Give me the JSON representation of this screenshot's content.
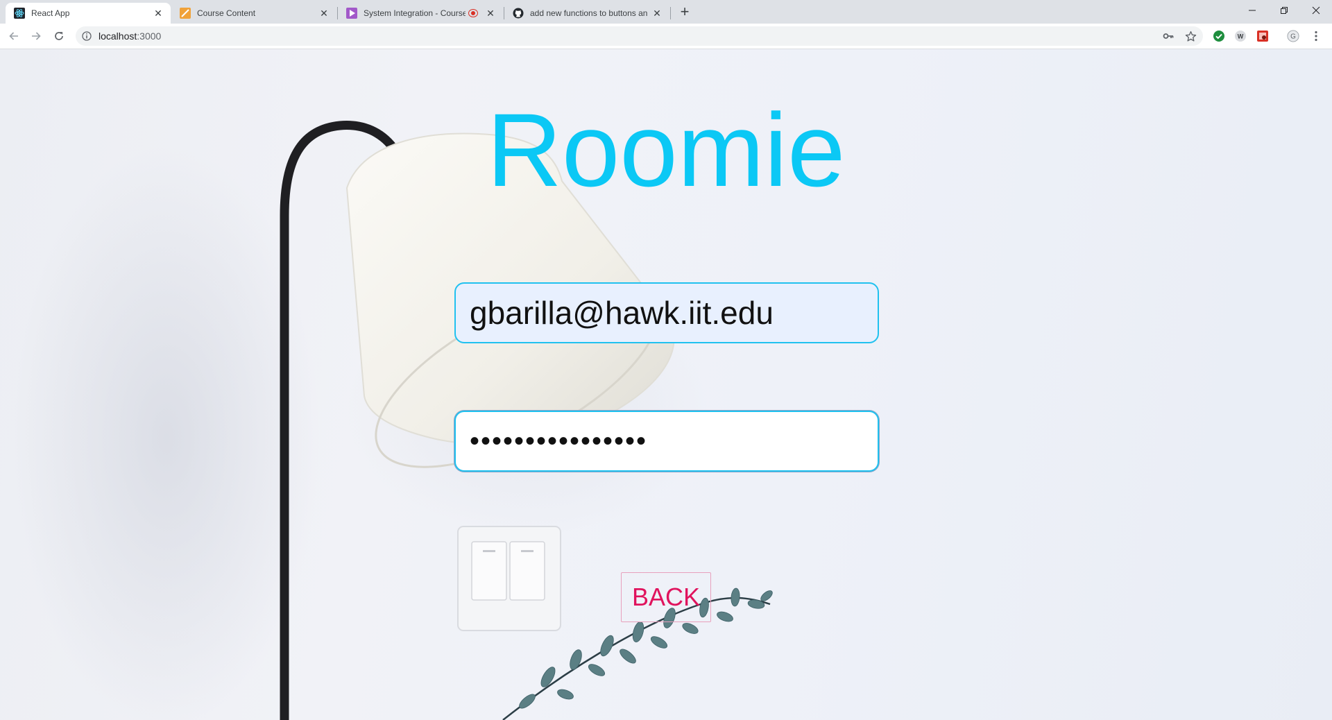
{
  "browser": {
    "tabs": [
      {
        "title": "React App",
        "favicon": "react-icon",
        "active": true
      },
      {
        "title": "Course Content",
        "favicon": "course-icon",
        "active": false
      },
      {
        "title": "System Integration - Course",
        "favicon": "video-icon",
        "active": false,
        "recording": true
      },
      {
        "title": "add new functions to buttons an",
        "favicon": "github-icon",
        "active": false
      }
    ],
    "new_tab": "+",
    "address_bar": {
      "host": "localhost",
      "port": ":3000"
    },
    "profile_initial": "G",
    "extension_w": "W"
  },
  "page": {
    "title": "Roomie",
    "email_value": "gbarilla@hawk.iit.edu",
    "password_value": "••••••••••••••••",
    "back_label": "BACK"
  },
  "colors": {
    "title": "#0bc8f5",
    "field_border": "#20c1ef",
    "back_text": "#e0135d"
  }
}
